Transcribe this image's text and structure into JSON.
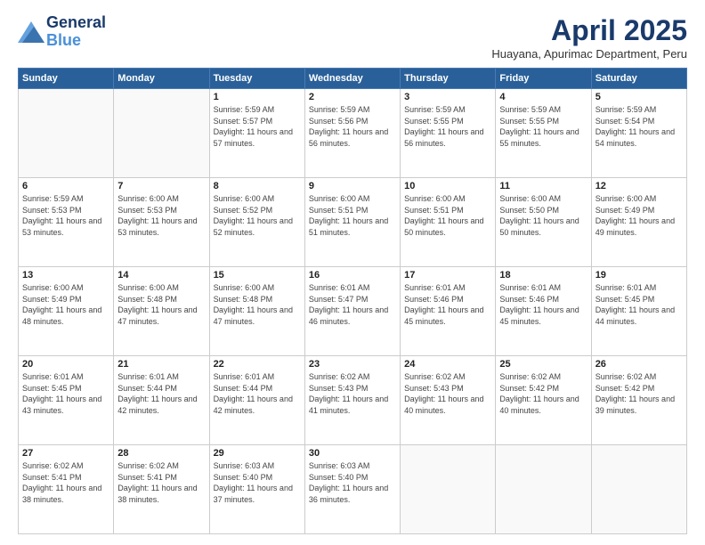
{
  "header": {
    "logo_line1": "General",
    "logo_line2": "Blue",
    "month_year": "April 2025",
    "location": "Huayana, Apurimac Department, Peru"
  },
  "days_of_week": [
    "Sunday",
    "Monday",
    "Tuesday",
    "Wednesday",
    "Thursday",
    "Friday",
    "Saturday"
  ],
  "weeks": [
    [
      {
        "day": "",
        "sunrise": "",
        "sunset": "",
        "daylight": ""
      },
      {
        "day": "",
        "sunrise": "",
        "sunset": "",
        "daylight": ""
      },
      {
        "day": "1",
        "sunrise": "Sunrise: 5:59 AM",
        "sunset": "Sunset: 5:57 PM",
        "daylight": "Daylight: 11 hours and 57 minutes."
      },
      {
        "day": "2",
        "sunrise": "Sunrise: 5:59 AM",
        "sunset": "Sunset: 5:56 PM",
        "daylight": "Daylight: 11 hours and 56 minutes."
      },
      {
        "day": "3",
        "sunrise": "Sunrise: 5:59 AM",
        "sunset": "Sunset: 5:55 PM",
        "daylight": "Daylight: 11 hours and 56 minutes."
      },
      {
        "day": "4",
        "sunrise": "Sunrise: 5:59 AM",
        "sunset": "Sunset: 5:55 PM",
        "daylight": "Daylight: 11 hours and 55 minutes."
      },
      {
        "day": "5",
        "sunrise": "Sunrise: 5:59 AM",
        "sunset": "Sunset: 5:54 PM",
        "daylight": "Daylight: 11 hours and 54 minutes."
      }
    ],
    [
      {
        "day": "6",
        "sunrise": "Sunrise: 5:59 AM",
        "sunset": "Sunset: 5:53 PM",
        "daylight": "Daylight: 11 hours and 53 minutes."
      },
      {
        "day": "7",
        "sunrise": "Sunrise: 6:00 AM",
        "sunset": "Sunset: 5:53 PM",
        "daylight": "Daylight: 11 hours and 53 minutes."
      },
      {
        "day": "8",
        "sunrise": "Sunrise: 6:00 AM",
        "sunset": "Sunset: 5:52 PM",
        "daylight": "Daylight: 11 hours and 52 minutes."
      },
      {
        "day": "9",
        "sunrise": "Sunrise: 6:00 AM",
        "sunset": "Sunset: 5:51 PM",
        "daylight": "Daylight: 11 hours and 51 minutes."
      },
      {
        "day": "10",
        "sunrise": "Sunrise: 6:00 AM",
        "sunset": "Sunset: 5:51 PM",
        "daylight": "Daylight: 11 hours and 50 minutes."
      },
      {
        "day": "11",
        "sunrise": "Sunrise: 6:00 AM",
        "sunset": "Sunset: 5:50 PM",
        "daylight": "Daylight: 11 hours and 50 minutes."
      },
      {
        "day": "12",
        "sunrise": "Sunrise: 6:00 AM",
        "sunset": "Sunset: 5:49 PM",
        "daylight": "Daylight: 11 hours and 49 minutes."
      }
    ],
    [
      {
        "day": "13",
        "sunrise": "Sunrise: 6:00 AM",
        "sunset": "Sunset: 5:49 PM",
        "daylight": "Daylight: 11 hours and 48 minutes."
      },
      {
        "day": "14",
        "sunrise": "Sunrise: 6:00 AM",
        "sunset": "Sunset: 5:48 PM",
        "daylight": "Daylight: 11 hours and 47 minutes."
      },
      {
        "day": "15",
        "sunrise": "Sunrise: 6:00 AM",
        "sunset": "Sunset: 5:48 PM",
        "daylight": "Daylight: 11 hours and 47 minutes."
      },
      {
        "day": "16",
        "sunrise": "Sunrise: 6:01 AM",
        "sunset": "Sunset: 5:47 PM",
        "daylight": "Daylight: 11 hours and 46 minutes."
      },
      {
        "day": "17",
        "sunrise": "Sunrise: 6:01 AM",
        "sunset": "Sunset: 5:46 PM",
        "daylight": "Daylight: 11 hours and 45 minutes."
      },
      {
        "day": "18",
        "sunrise": "Sunrise: 6:01 AM",
        "sunset": "Sunset: 5:46 PM",
        "daylight": "Daylight: 11 hours and 45 minutes."
      },
      {
        "day": "19",
        "sunrise": "Sunrise: 6:01 AM",
        "sunset": "Sunset: 5:45 PM",
        "daylight": "Daylight: 11 hours and 44 minutes."
      }
    ],
    [
      {
        "day": "20",
        "sunrise": "Sunrise: 6:01 AM",
        "sunset": "Sunset: 5:45 PM",
        "daylight": "Daylight: 11 hours and 43 minutes."
      },
      {
        "day": "21",
        "sunrise": "Sunrise: 6:01 AM",
        "sunset": "Sunset: 5:44 PM",
        "daylight": "Daylight: 11 hours and 42 minutes."
      },
      {
        "day": "22",
        "sunrise": "Sunrise: 6:01 AM",
        "sunset": "Sunset: 5:44 PM",
        "daylight": "Daylight: 11 hours and 42 minutes."
      },
      {
        "day": "23",
        "sunrise": "Sunrise: 6:02 AM",
        "sunset": "Sunset: 5:43 PM",
        "daylight": "Daylight: 11 hours and 41 minutes."
      },
      {
        "day": "24",
        "sunrise": "Sunrise: 6:02 AM",
        "sunset": "Sunset: 5:43 PM",
        "daylight": "Daylight: 11 hours and 40 minutes."
      },
      {
        "day": "25",
        "sunrise": "Sunrise: 6:02 AM",
        "sunset": "Sunset: 5:42 PM",
        "daylight": "Daylight: 11 hours and 40 minutes."
      },
      {
        "day": "26",
        "sunrise": "Sunrise: 6:02 AM",
        "sunset": "Sunset: 5:42 PM",
        "daylight": "Daylight: 11 hours and 39 minutes."
      }
    ],
    [
      {
        "day": "27",
        "sunrise": "Sunrise: 6:02 AM",
        "sunset": "Sunset: 5:41 PM",
        "daylight": "Daylight: 11 hours and 38 minutes."
      },
      {
        "day": "28",
        "sunrise": "Sunrise: 6:02 AM",
        "sunset": "Sunset: 5:41 PM",
        "daylight": "Daylight: 11 hours and 38 minutes."
      },
      {
        "day": "29",
        "sunrise": "Sunrise: 6:03 AM",
        "sunset": "Sunset: 5:40 PM",
        "daylight": "Daylight: 11 hours and 37 minutes."
      },
      {
        "day": "30",
        "sunrise": "Sunrise: 6:03 AM",
        "sunset": "Sunset: 5:40 PM",
        "daylight": "Daylight: 11 hours and 36 minutes."
      },
      {
        "day": "",
        "sunrise": "",
        "sunset": "",
        "daylight": ""
      },
      {
        "day": "",
        "sunrise": "",
        "sunset": "",
        "daylight": ""
      },
      {
        "day": "",
        "sunrise": "",
        "sunset": "",
        "daylight": ""
      }
    ]
  ]
}
